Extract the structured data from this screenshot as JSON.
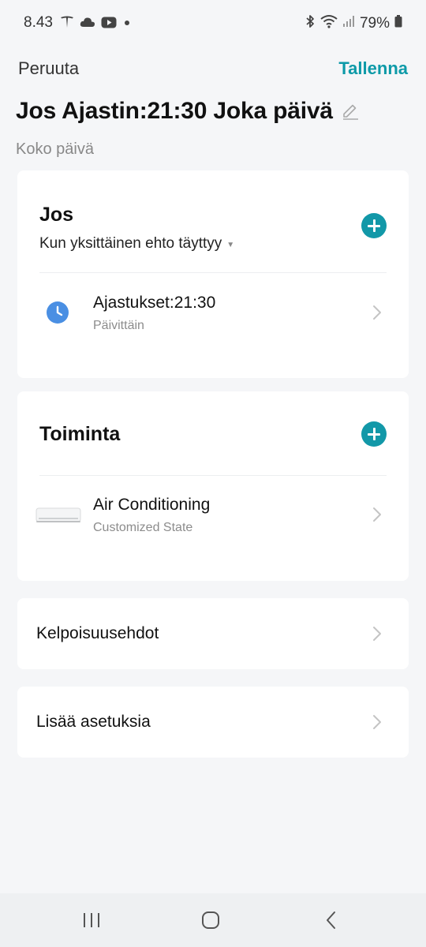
{
  "status": {
    "time": "8.43",
    "battery": "79%",
    "left_icons": [
      "tesla-icon",
      "cloud-icon",
      "youtube-icon",
      "dot-icon"
    ],
    "right_icons": [
      "bluetooth-icon",
      "wifi-icon",
      "signal-icon",
      "battery-icon"
    ]
  },
  "header": {
    "cancel_label": "Peruuta",
    "save_label": "Tallenna",
    "title": "Jos Ajastin:21:30 Joka päivä",
    "subtitle": "Koko päivä"
  },
  "if_section": {
    "title": "Jos",
    "condition_mode": "Kun yksittäinen ehto täyttyy",
    "item": {
      "title": "Ajastukset:21:30",
      "subtitle": "Päivittäin",
      "icon": "clock-icon"
    }
  },
  "action_section": {
    "title": "Toiminta",
    "item": {
      "title": "Air Conditioning",
      "subtitle": "Customized State",
      "icon": "air-conditioner-icon"
    }
  },
  "eligibility": {
    "label": "Kelpoisuusehdot"
  },
  "more_settings": {
    "label": "Lisää asetuksia"
  },
  "colors": {
    "accent": "#0d9aa8",
    "background": "#f5f6f8",
    "clock": "#4a8fe3"
  }
}
